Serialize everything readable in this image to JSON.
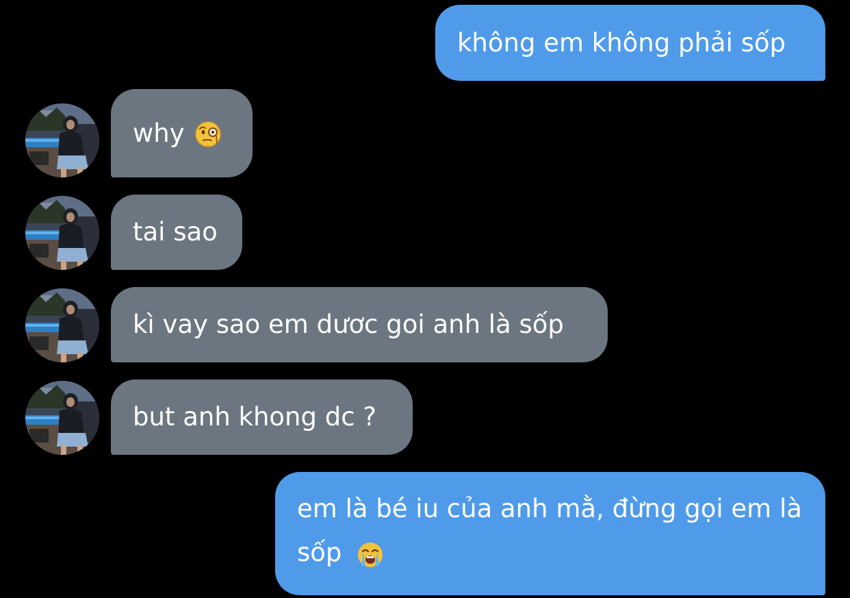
{
  "messages": [
    {
      "id": "m1",
      "direction": "sent",
      "text": "không em không phải sốp"
    },
    {
      "id": "m2",
      "direction": "received",
      "text": "why",
      "emoji": "face-with-monocle-icon"
    },
    {
      "id": "m3",
      "direction": "received",
      "text": "tai sao"
    },
    {
      "id": "m4",
      "direction": "received",
      "text": "kì vay sao em dươc goi anh là sốp"
    },
    {
      "id": "m5",
      "direction": "received",
      "text": "but anh khong dc ?"
    },
    {
      "id": "m6",
      "direction": "sent",
      "text": "em là bé iu của anh mằ, đừng gọi em là sốp",
      "emoji": "loudly-crying-face-icon"
    }
  ],
  "colors": {
    "background": "#000000",
    "sent_bubble": "#4f9bea",
    "received_bubble": "#6b7680",
    "text": "#ffffff"
  }
}
